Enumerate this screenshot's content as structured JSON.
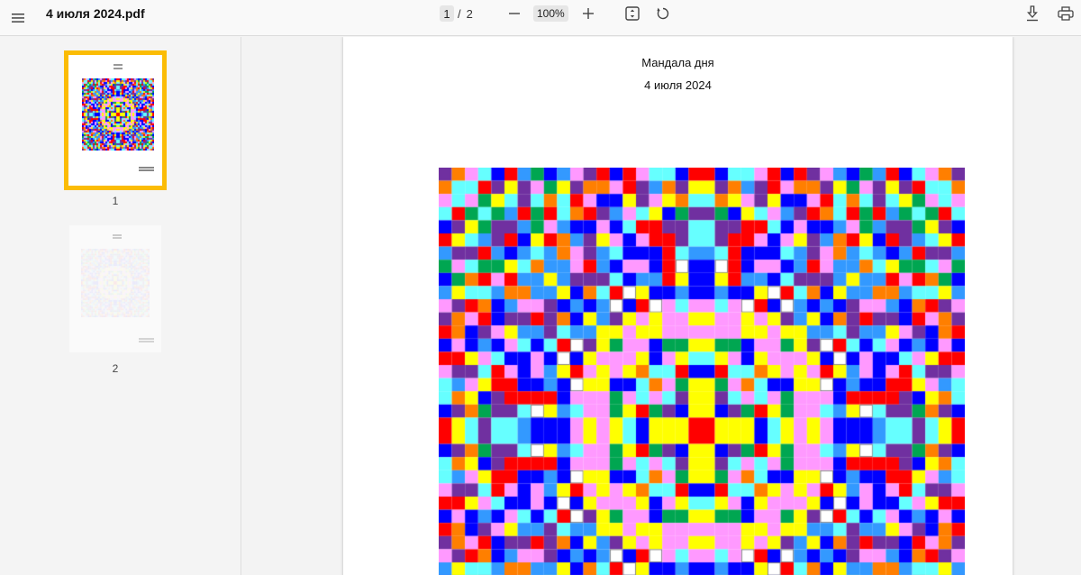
{
  "toolbar": {
    "menu_icon": "hamburger-menu-icon",
    "title": "4 июля 2024.pdf",
    "current_page": "1",
    "page_separator": "/",
    "total_pages": "2",
    "zoom_out_icon": "minus-icon",
    "zoom_level": "100%",
    "zoom_in_icon": "plus-icon",
    "fit_icon": "fit-page-icon",
    "rotate_icon": "rotate-icon",
    "download_icon": "download-icon",
    "print_icon": "print-icon"
  },
  "sidebar": {
    "thumbnails": [
      {
        "label": "1",
        "selected": true
      },
      {
        "label": "2",
        "selected": false
      }
    ],
    "selection_color": "#fbbc05"
  },
  "document": {
    "heading": "Мандала дня",
    "date": "4 июля 2024"
  },
  "mandala": {
    "palette": [
      "#0000ff",
      "#ff0000",
      "#ffff00",
      "#00a651",
      "#ff7f00",
      "#7030a0",
      "#ff99ff",
      "#66ffff",
      "#3399ff",
      "#ffffff"
    ]
  }
}
